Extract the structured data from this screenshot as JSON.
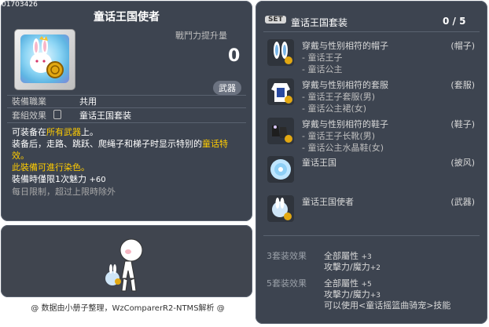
{
  "item_id": "01703426",
  "title": "童话王国使者",
  "combat": {
    "label": "戰鬥力提升量",
    "value": "0"
  },
  "badge": "武器",
  "job": {
    "label": "裝備職業",
    "value": "共用"
  },
  "set_effect": {
    "label": "套組效果",
    "value": "童话王国套装"
  },
  "desc": {
    "line1_a": "可装备在",
    "line1_b": "所有武器",
    "line1_c": "上。",
    "line2_a": "装备后，走路、跳跃、爬绳子和梯子时显示特别的",
    "line2_b": "童话特",
    "line3": "效。",
    "line4": "此裝備可進行染色。",
    "line5_a": "裝備時僅限1次魅力",
    "line5_b": "+60",
    "line6": "每日限制，超过上限時除外"
  },
  "set_panel": {
    "set_tag": "SET",
    "name": "童话王国套装",
    "count": "0 / 5",
    "items": [
      {
        "name": "穿戴与性别相符的帽子",
        "slot": "(帽子)",
        "sub": [
          "- 童话王子",
          "- 童话公主"
        ],
        "icon": "bunny-hat-icon"
      },
      {
        "name": "穿戴与性别相符的套服",
        "slot": "(套服)",
        "sub": [
          "- 童话王子套服(男)",
          "- 童话公主裙(女)"
        ],
        "icon": "outfit-icon"
      },
      {
        "name": "穿戴与性别相符的鞋子",
        "slot": "(鞋子)",
        "sub": [
          "- 童话王子长靴(男)",
          "- 童话公主水晶鞋(女)"
        ],
        "icon": "shoes-icon"
      },
      {
        "name": "童话王国",
        "slot": "(披风)",
        "sub": [],
        "icon": "cape-icon"
      },
      {
        "name": "童话王国使者",
        "slot": "(武器)",
        "sub": [],
        "icon": "bunny-weapon-icon"
      }
    ],
    "bonus": [
      {
        "head": "3套装效果",
        "lines": [
          [
            "全部屬性",
            "+3"
          ],
          [
            "攻擊力/魔力",
            "+2"
          ]
        ]
      },
      {
        "head": "5套装效果",
        "lines": [
          [
            "全部屬性",
            "+5"
          ],
          [
            "攻擊力/魔力",
            "+3"
          ],
          [
            "可以使用<童话摇篮曲骑宠>技能",
            ""
          ]
        ]
      }
    ]
  },
  "footer": "@ 数据由小册子整理，WzComparerR2-NTMS解析 @",
  "colors": {
    "panel": "#3d4450",
    "highlight": "#ffcc00"
  }
}
